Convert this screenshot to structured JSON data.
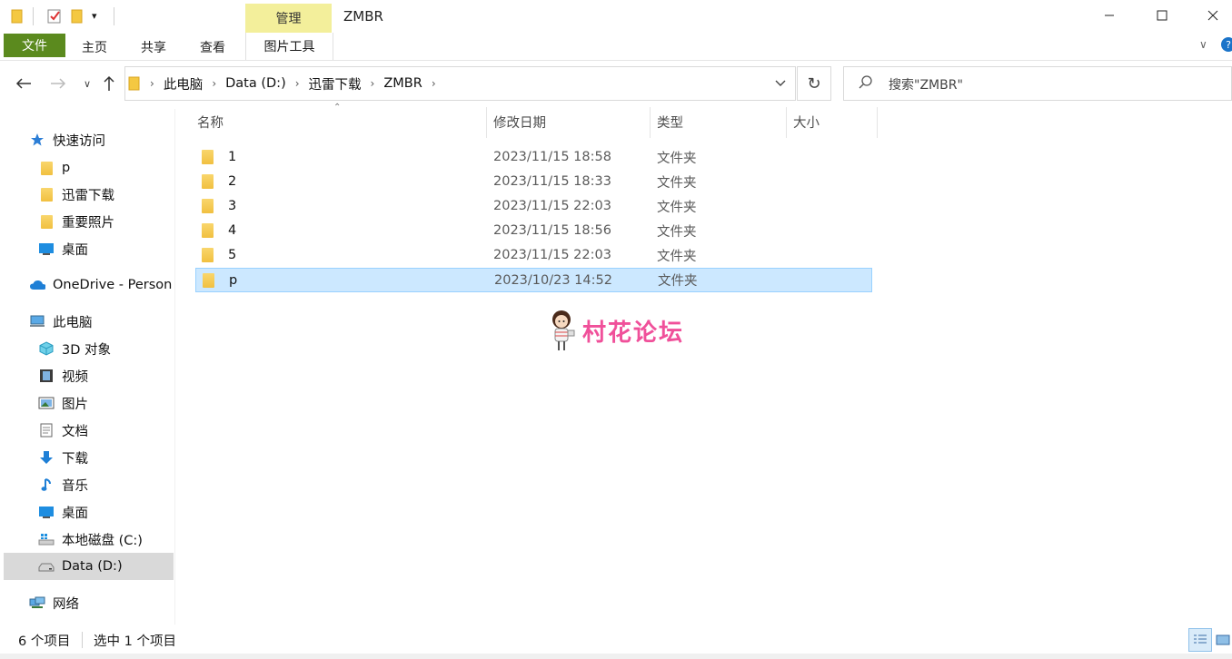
{
  "window": {
    "title": "ZMBR",
    "context_tab": "管理",
    "context_subtab": "图片工具"
  },
  "ribbon": {
    "tabs": [
      "文件",
      "主页",
      "共享",
      "查看"
    ]
  },
  "address": {
    "crumbs": [
      "此电脑",
      "Data (D:)",
      "迅雷下载",
      "ZMBR"
    ]
  },
  "search": {
    "placeholder": "搜索\"ZMBR\""
  },
  "sidebar": {
    "items": [
      {
        "label": "快速访问",
        "icon": "star-icon"
      },
      {
        "label": "p",
        "icon": "folder-icon"
      },
      {
        "label": "迅雷下载",
        "icon": "folder-icon"
      },
      {
        "label": "重要照片",
        "icon": "folder-icon"
      },
      {
        "label": "桌面",
        "icon": "desktop-icon"
      },
      {
        "label": "OneDrive - Person",
        "icon": "cloud-icon"
      },
      {
        "label": "此电脑",
        "icon": "computer-icon"
      },
      {
        "label": "3D 对象",
        "icon": "cube-icon"
      },
      {
        "label": "视频",
        "icon": "video-icon"
      },
      {
        "label": "图片",
        "icon": "picture-icon"
      },
      {
        "label": "文档",
        "icon": "document-icon"
      },
      {
        "label": "下载",
        "icon": "download-arrow-icon"
      },
      {
        "label": "音乐",
        "icon": "music-note-icon"
      },
      {
        "label": "桌面",
        "icon": "desktop-icon"
      },
      {
        "label": "本地磁盘 (C:)",
        "icon": "windows-drive-icon"
      },
      {
        "label": "Data (D:)",
        "icon": "drive-icon"
      },
      {
        "label": "网络",
        "icon": "network-icon"
      }
    ]
  },
  "columns": {
    "name": "名称",
    "modified": "修改日期",
    "type": "类型",
    "size": "大小"
  },
  "files": [
    {
      "name": "1",
      "modified": "2023/11/15 18:58",
      "type": "文件夹"
    },
    {
      "name": "2",
      "modified": "2023/11/15 18:33",
      "type": "文件夹"
    },
    {
      "name": "3",
      "modified": "2023/11/15 22:03",
      "type": "文件夹"
    },
    {
      "name": "4",
      "modified": "2023/11/15 18:56",
      "type": "文件夹"
    },
    {
      "name": "5",
      "modified": "2023/11/15 22:03",
      "type": "文件夹"
    },
    {
      "name": "p",
      "modified": "2023/10/23 14:52",
      "type": "文件夹"
    }
  ],
  "watermark": {
    "text": "村花论坛"
  },
  "status": {
    "count": "6 个项目",
    "selected": "选中 1 个项目"
  },
  "colors": {
    "file_tab": "#5b8a1e",
    "context_tab": "#f3ef9b",
    "selection": "#cce8ff",
    "watermark": "#f0509a"
  }
}
